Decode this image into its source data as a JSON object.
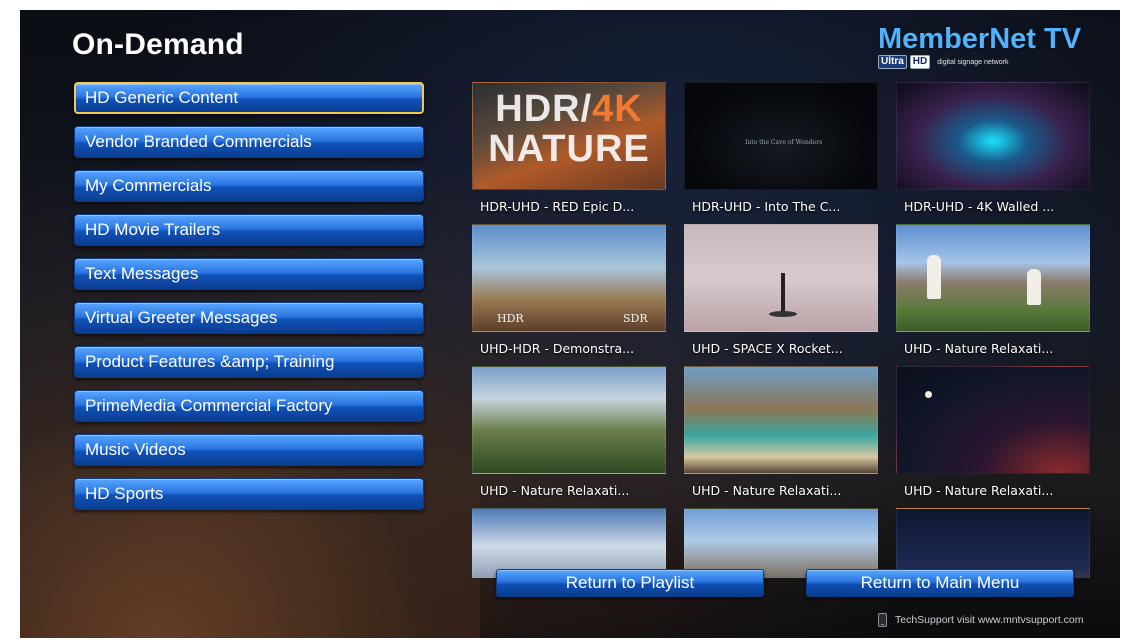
{
  "header": {
    "title": "On-Demand",
    "logo_name": "MemberNet TV",
    "logo_badge_ultra": "Ultra",
    "logo_badge_hd": "HD",
    "logo_tagline": "digital signage network"
  },
  "menu": {
    "items": [
      {
        "label": "HD Generic Content",
        "selected": true
      },
      {
        "label": "Vendor Branded Commercials",
        "selected": false
      },
      {
        "label": "My Commercials",
        "selected": false
      },
      {
        "label": "HD Movie Trailers",
        "selected": false
      },
      {
        "label": "Text Messages",
        "selected": false
      },
      {
        "label": "Virtual Greeter Messages",
        "selected": false
      },
      {
        "label": "Product Features &amp; Training",
        "selected": false
      },
      {
        "label": "PrimeMedia Commercial Factory",
        "selected": false
      },
      {
        "label": "Music Videos",
        "selected": false
      },
      {
        "label": "HD Sports",
        "selected": false
      }
    ]
  },
  "grid": {
    "tiles": [
      {
        "caption": "HDR-UHD - RED Epic D...",
        "thumb_text_1": "HDR/",
        "thumb_text_2": "4K",
        "thumb_text_3": "NATURE"
      },
      {
        "caption": "HDR-UHD - Into The C...",
        "thumb_text": "Into the Cave of Wonders"
      },
      {
        "caption": "HDR-UHD - 4K Walled ..."
      },
      {
        "caption": "UHD-HDR - Demonstra...",
        "thumb_label_left": "HDR",
        "thumb_label_right": "SDR"
      },
      {
        "caption": "UHD - SPACE X Rocket..."
      },
      {
        "caption": "UHD - Nature Relaxati..."
      },
      {
        "caption": "UHD - Nature Relaxati..."
      },
      {
        "caption": "UHD - Nature Relaxati..."
      },
      {
        "caption": "UHD - Nature Relaxati..."
      },
      {
        "caption": ""
      },
      {
        "caption": ""
      },
      {
        "caption": ""
      }
    ]
  },
  "actions": {
    "return_playlist": "Return to Playlist",
    "return_main": "Return to Main Menu"
  },
  "footer": {
    "support_text": "TechSupport visit www.mntvsupport.com"
  },
  "colors": {
    "button_blue": "#2b76e2",
    "selected_border": "#f3c94a",
    "logo_blue": "#4fb3ff"
  },
  "icons": {
    "support": "phone-icon"
  }
}
